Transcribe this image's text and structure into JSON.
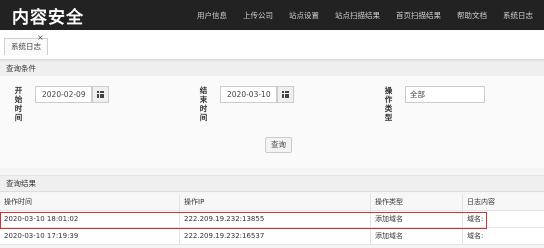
{
  "app": {
    "title": "内容安全"
  },
  "nav": [
    "用户信息",
    "上传公司",
    "站点设置",
    "站点扫描结果",
    "首页扫描结果",
    "帮助文档",
    "系统日志"
  ],
  "tab": {
    "label": "系统日志",
    "close": "×"
  },
  "query": {
    "section_title": "查询条件",
    "start_label": [
      "开",
      "始",
      "时",
      "间"
    ],
    "start_value": "2020-02-09",
    "end_label": [
      "结",
      "束",
      "时",
      "间"
    ],
    "end_value": "2020-03-10",
    "type_label": [
      "操",
      "作",
      "类",
      "型"
    ],
    "type_value": "全部",
    "button": "查询"
  },
  "results": {
    "section_title": "查询结果",
    "columns": [
      "操作时间",
      "操作IP",
      "操作类型",
      "日志内容"
    ],
    "rows": [
      [
        "2020-03-10 18:01:02",
        "222.209.19.232:13855",
        "添加域名",
        "域名:"
      ],
      [
        "2020-03-10 17:19:39",
        "222.209.19.232:16537",
        "添加域名",
        "域名:"
      ]
    ],
    "highlight_color": "#d32f2f"
  }
}
